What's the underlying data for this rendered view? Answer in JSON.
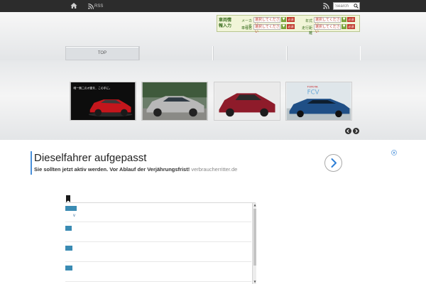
{
  "topbar": {
    "rss_label": "RSS",
    "search_placeholder": "Search",
    "icons": [
      "home-icon",
      "rss-icon",
      "search-icon"
    ]
  },
  "vehicle_form": {
    "title": "車両情報入力",
    "fields": [
      {
        "label": "メーカー名",
        "value": "選択してください",
        "badge": "必須"
      },
      {
        "label": "車種名",
        "value": "選択してください",
        "badge": "必須"
      },
      {
        "label": "年式",
        "value": "選択してください",
        "badge": "必須"
      },
      {
        "label": "走行距離",
        "value": "選択してください",
        "badge": "必須"
      }
    ]
  },
  "nav": {
    "tabs": [
      {
        "label": "TOP",
        "active": true
      },
      {
        "label": "",
        "active": false
      },
      {
        "label": "",
        "active": false
      },
      {
        "label": "",
        "active": false
      }
    ]
  },
  "carousel": {
    "slides": [
      {
        "caption": "唯一無二の才能を、この手に。",
        "car_color": "#c4161c"
      },
      {
        "caption": "",
        "car_color": "#b8b8b8"
      },
      {
        "caption": "",
        "car_color": "#8e1b2a"
      },
      {
        "caption": "FCV",
        "brand": "TOYOTA",
        "car_color": "#1f4f86"
      }
    ]
  },
  "ad": {
    "title": "Dieselfahrer aufgepasst",
    "text": "Sie sollten jetzt aktiv werden. Vor Ablauf der Verjährungsfrist!",
    "domain": "verbraucherritter.de",
    "accent": "#4a90d9"
  },
  "list": {
    "items": [
      {
        "sub": "v"
      },
      {
        "sub": ""
      },
      {
        "sub": ""
      },
      {
        "sub": ""
      }
    ]
  },
  "colors": {
    "topbar": "#2c2c2c",
    "form_green": "#3a6e1f",
    "badge_red": "#c0392b",
    "tag_blue": "#3a8bb3"
  }
}
